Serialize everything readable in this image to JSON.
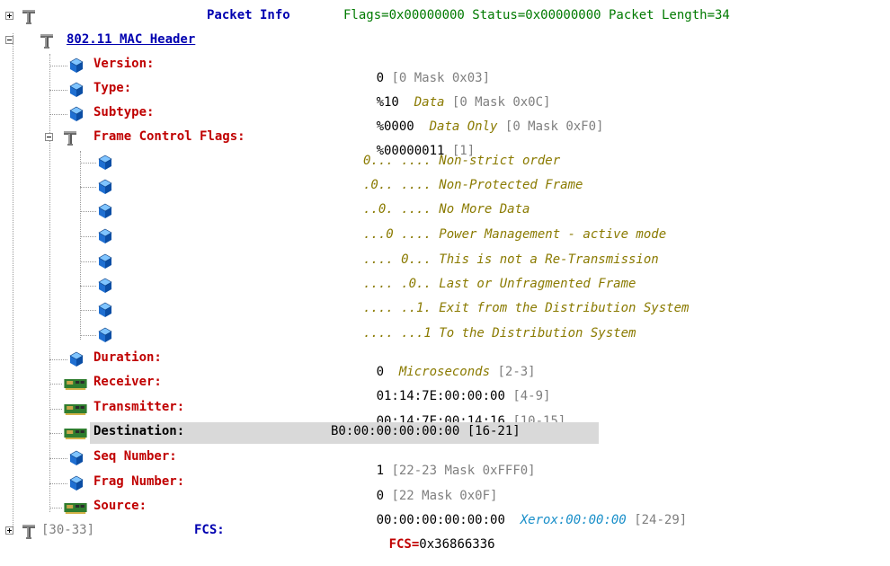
{
  "packet_info": {
    "label": "Packet Info",
    "summary": "Flags=0x00000000 Status=0x00000000 Packet Length=34"
  },
  "mac_header": {
    "label": "802.11 MAC Header"
  },
  "fields": {
    "version": {
      "label": "Version:",
      "value": "0",
      "range": "[0 Mask 0x03]"
    },
    "type": {
      "label": "Type:",
      "value": "%10",
      "desc": "Data",
      "range": "[0 Mask 0x0C]"
    },
    "subtype": {
      "label": "Subtype:",
      "value": "%0000",
      "desc": "Data Only",
      "range": "[0 Mask 0xF0]"
    },
    "fcf": {
      "label": "Frame Control Flags:",
      "value": "%00000011",
      "range": "[1]"
    },
    "duration": {
      "label": "Duration:",
      "value": "0",
      "desc": "Microseconds",
      "range": "[2-3]"
    },
    "receiver": {
      "label": "Receiver:",
      "value": "01:14:7E:00:00:00",
      "range": "[4-9]"
    },
    "transmitter": {
      "label": "Transmitter:",
      "value": "00:14:7E:00:14:16",
      "range": "[10-15]"
    },
    "destination": {
      "label": "Destination:",
      "value": "B0:00:00:00:00:00 [16-21]"
    },
    "seq": {
      "label": "Seq Number:",
      "value": "1",
      "range": "[22-23 Mask 0xFFF0]"
    },
    "frag": {
      "label": "Frag Number:",
      "value": "0",
      "range": "[22 Mask 0x0F]"
    },
    "source": {
      "label": "Source:",
      "value": "00:00:00:00:00:00",
      "desc": "Xerox:00:00:00",
      "range": "[24-29]"
    }
  },
  "flags": [
    "0... .... Non-strict order",
    ".0.. .... Non-Protected Frame",
    "..0. .... No More Data",
    "...0 .... Power Management - active mode",
    ".... 0... This is not a Re-Transmission",
    ".... .0.. Last or Unfragmented Frame",
    ".... ..1. Exit from the Distribution System",
    ".... ...1 To the Distribution System"
  ],
  "fcs": {
    "range": "[30-33]",
    "label": "FCS:",
    "value_prefix": "FCS=",
    "value": "0x36866336"
  },
  "icons": {
    "wrench": "wrench-icon",
    "cube": "blue-cube-icon",
    "nic": "network-card-icon"
  }
}
